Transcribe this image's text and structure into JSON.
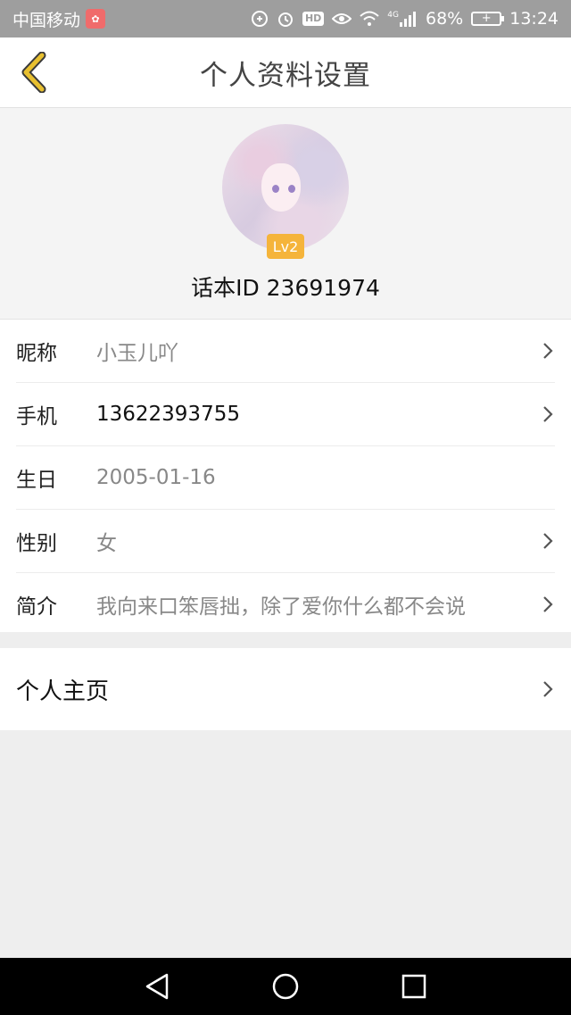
{
  "status_bar": {
    "carrier": "中国移动",
    "network": "4G",
    "battery": "68%",
    "time": "13:24",
    "hd": "HD"
  },
  "header": {
    "title": "个人资料设置",
    "back_icon": "chevron-left-icon"
  },
  "profile": {
    "level": "Lv2",
    "id_text": "话本ID 23691974"
  },
  "info_rows": [
    {
      "label": "昵称",
      "value": "小玉儿吖",
      "has_arrow": true
    },
    {
      "label": "手机",
      "value": "13622393755",
      "has_arrow": true
    },
    {
      "label": "生日",
      "value": "2005-01-16",
      "has_arrow": false
    },
    {
      "label": "性别",
      "value": "女",
      "has_arrow": true
    },
    {
      "label": "简介",
      "value": "我向来口笨唇拙，除了爱你什么都不会说",
      "has_arrow": true
    }
  ],
  "home_page": {
    "label": "个人主页"
  },
  "colors": {
    "accent": "#f5b43b",
    "back_icon": "#e8c030",
    "status_bar": "#9e9e9e"
  }
}
